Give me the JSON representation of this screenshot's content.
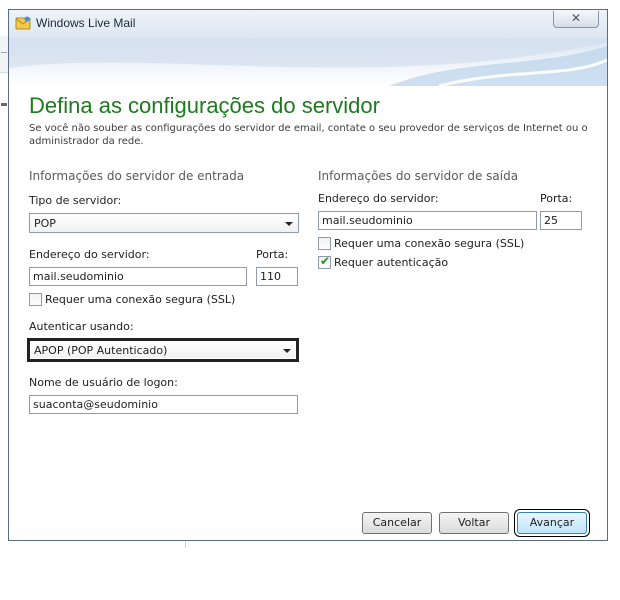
{
  "window": {
    "title": "Windows Live Mail",
    "close_glyph": "✕",
    "app_icon": "windows-live-mail-icon"
  },
  "heading": "Defina as configurações do servidor",
  "subtext": "Se você não souber as configurações do servidor de email, contate o seu provedor de serviços de Internet ou o administrador da rede.",
  "incoming": {
    "section_title": "Informações do servidor de entrada",
    "server_type_label": "Tipo de servidor:",
    "server_type_value": "POP",
    "server_address_label": "Endereço do servidor:",
    "server_address_value": "mail.seudominio",
    "port_label": "Porta:",
    "port_value": "110",
    "ssl_label": "Requer uma conexão segura (SSL)",
    "ssl_checked": false,
    "auth_label": "Autenticar usando:",
    "auth_value": "APOP (POP Autenticado)",
    "logon_label": "Nome de usuário de logon:",
    "logon_value": "suaconta@seudominio"
  },
  "outgoing": {
    "section_title": "Informações do servidor de saída",
    "server_address_label": "Endereço do servidor:",
    "server_address_value": "mail.seudominio",
    "port_label": "Porta:",
    "port_value": "25",
    "ssl_label": "Requer uma conexão segura (SSL)",
    "ssl_checked": false,
    "auth_required_label": "Requer autenticação",
    "auth_required_checked": true
  },
  "buttons": {
    "cancel": "Cancelar",
    "back": "Voltar",
    "next": "Avançar"
  },
  "colors": {
    "heading_green": "#1e7a1e",
    "window_border": "#5b6d84"
  }
}
